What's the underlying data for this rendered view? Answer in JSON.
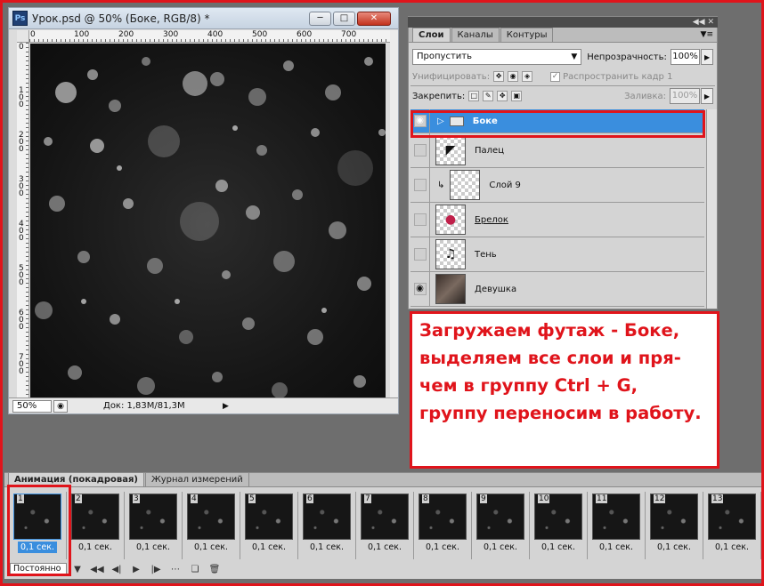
{
  "document": {
    "title": "Урок.psd @ 50% (Боке, RGB/8) *",
    "ps_icon": "Ps",
    "ruler_top_labels": [
      "0",
      "100",
      "200",
      "300",
      "400",
      "500",
      "600",
      "700"
    ],
    "ruler_left_labels": [
      "0",
      "1 0 0",
      "2 0 0",
      "3 0 0",
      "4 0 0",
      "5 0 0",
      "6 0 0",
      "7 0 0"
    ],
    "zoom": "50%",
    "doc_size": "Док: 1,83M/81,3M"
  },
  "layers_panel": {
    "tabs": [
      "Слои",
      "Каналы",
      "Контуры"
    ],
    "blend_mode": "Пропустить",
    "opacity_label": "Непрозрачность:",
    "opacity_value": "100%",
    "unify_label": "Унифицировать:",
    "propagate_label": "Распространить кадр 1",
    "lock_label": "Закрепить:",
    "fill_label": "Заливка:",
    "fill_value": "100%",
    "layers": [
      {
        "name": "Боке"
      },
      {
        "name": "Палец"
      },
      {
        "name": "Слой 9"
      },
      {
        "name": "Брелок"
      },
      {
        "name": "Тень"
      },
      {
        "name": "Девушка"
      }
    ]
  },
  "annotation": {
    "text": "Загружаем футаж - Боке, выделяем все слои и пря- чем в группу Ctrl + G, группу переносим в работу."
  },
  "animation": {
    "tabs": [
      "Анимация (покадровая)",
      "Журнал измерений"
    ],
    "frames": [
      {
        "num": "1",
        "delay": "0,1 сек."
      },
      {
        "num": "2",
        "delay": "0,1 сек."
      },
      {
        "num": "3",
        "delay": "0,1 сек."
      },
      {
        "num": "4",
        "delay": "0,1 сек."
      },
      {
        "num": "5",
        "delay": "0,1 сек."
      },
      {
        "num": "6",
        "delay": "0,1 сек."
      },
      {
        "num": "7",
        "delay": "0,1 сек."
      },
      {
        "num": "8",
        "delay": "0,1 сек."
      },
      {
        "num": "9",
        "delay": "0,1 сек."
      },
      {
        "num": "10",
        "delay": "0,1 сек."
      },
      {
        "num": "11",
        "delay": "0,1 сек."
      },
      {
        "num": "12",
        "delay": "0,1 сек."
      },
      {
        "num": "13",
        "delay": "0,1 сек."
      }
    ],
    "loop": "Постоянно"
  },
  "colors": {
    "highlight_red": "#e0141b",
    "selection_blue": "#3a8ede"
  }
}
